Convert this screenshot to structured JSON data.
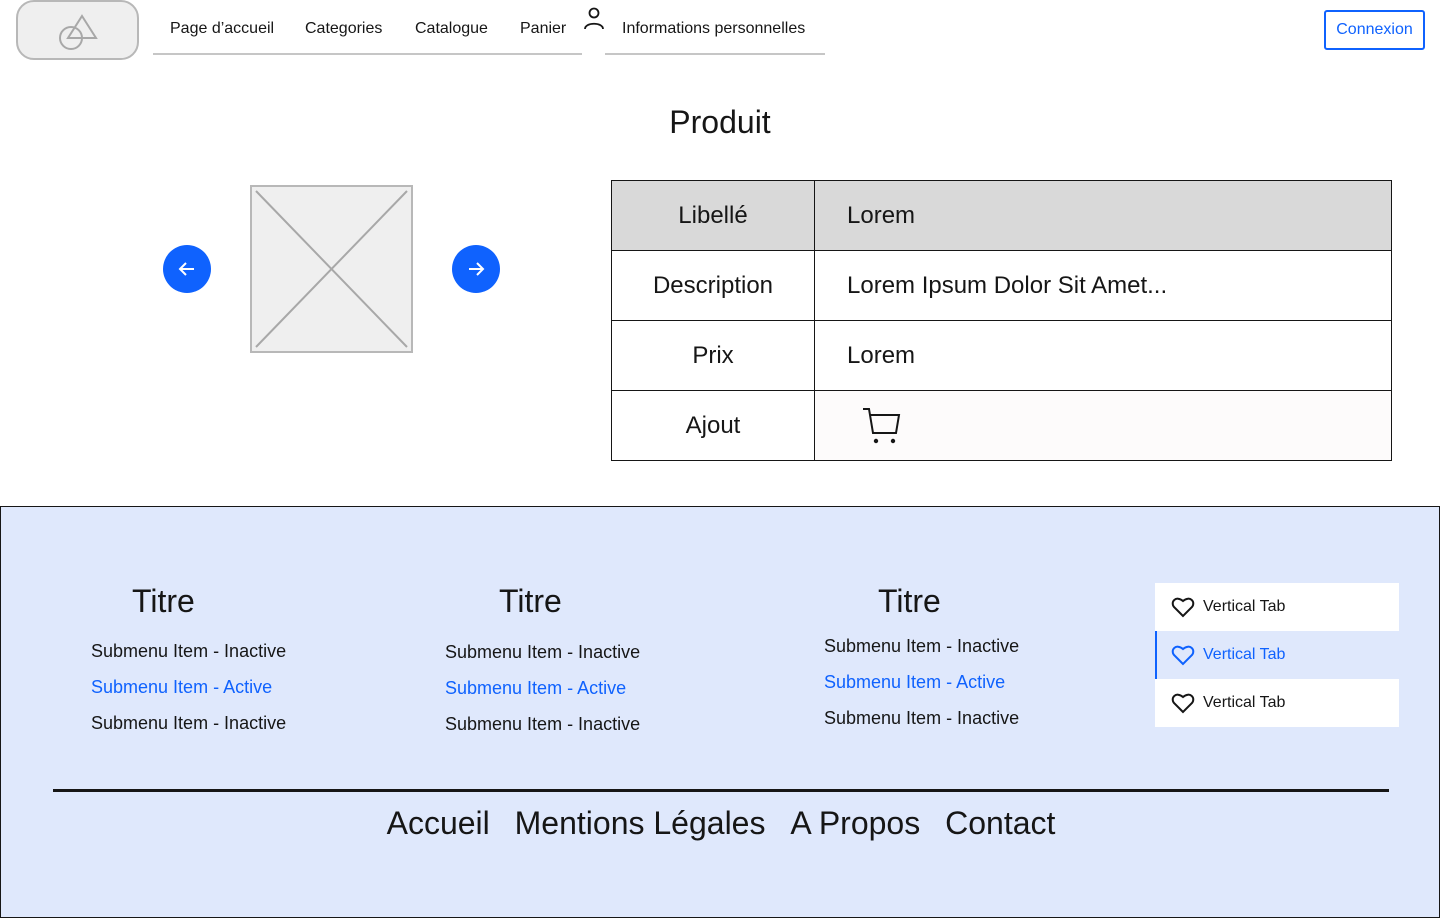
{
  "header": {
    "nav": [
      {
        "label": "Page d’accueil"
      },
      {
        "label": "Categories"
      },
      {
        "label": "Catalogue"
      },
      {
        "label": "Panier"
      },
      {
        "label": "Informations personnelles"
      }
    ],
    "login_label": "Connexion"
  },
  "main": {
    "title": "Produit",
    "table": {
      "header": {
        "label": "Libellé",
        "value": "Lorem"
      },
      "rows": [
        {
          "label": "Description",
          "value": "Lorem Ipsum Dolor Sit Amet..."
        },
        {
          "label": "Prix",
          "value": "Lorem"
        },
        {
          "label": "Ajout",
          "icon": "cart-icon"
        }
      ]
    }
  },
  "footer": {
    "columns": [
      {
        "title": "Titre",
        "items": [
          {
            "label": "Submenu Item - Inactive"
          },
          {
            "label": "Submenu Item - Active"
          },
          {
            "label": "Submenu Item - Inactive"
          }
        ]
      },
      {
        "title": "Titre",
        "items": [
          {
            "label": "Submenu Item - Inactive"
          },
          {
            "label": "Submenu Item - Active"
          },
          {
            "label": "Submenu Item - Inactive"
          }
        ]
      },
      {
        "title": "Titre",
        "items": [
          {
            "label": "Submenu Item - Inactive"
          },
          {
            "label": "Submenu Item - Active"
          },
          {
            "label": "Submenu Item - Inactive"
          }
        ]
      }
    ],
    "vertical_tabs": [
      {
        "label": "Vertical Tab",
        "icon": "heart-icon"
      },
      {
        "label": "Vertical Tab",
        "icon": "heart-icon"
      },
      {
        "label": "Vertical Tab",
        "icon": "heart-icon"
      }
    ],
    "links": [
      {
        "label": "Accueil"
      },
      {
        "label": "Mentions Légales"
      },
      {
        "label": "A Propos"
      },
      {
        "label": "Contact"
      }
    ]
  },
  "colors": {
    "accent": "#0f62fe",
    "footer_bg": "#dfe8fc",
    "table_header_bg": "#d9d9d9"
  }
}
